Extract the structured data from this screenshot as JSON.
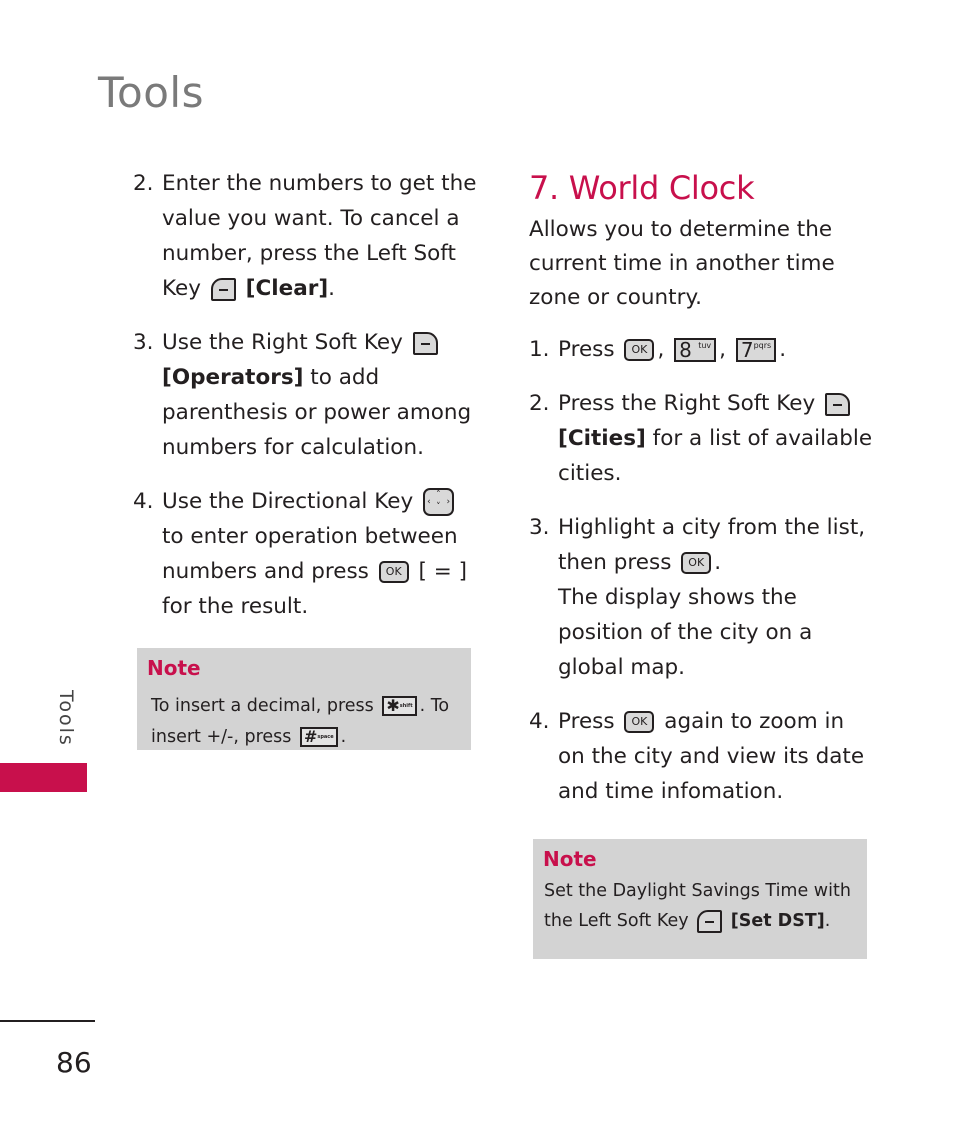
{
  "page": {
    "title": "Tools",
    "side_label": "Tools",
    "page_number": "86",
    "accent_color": "#c8104c"
  },
  "left_column": {
    "steps": [
      {
        "number": "2.",
        "text_before": "Enter the numbers to get the value you want. To cancel a number, press the Left Soft Key",
        "key_icon": "left-soft-key-icon",
        "bold_label": "[Clear]",
        "text_after": "."
      },
      {
        "number": "3.",
        "text_before": "Use the Right Soft Key",
        "key_icon": "right-soft-key-icon",
        "bold_label": "[Operators]",
        "text_after": " to add parenthesis or power among numbers for calculation."
      },
      {
        "number": "4.",
        "text_before": "Use the Directional Key",
        "key_icon": "directional-key-icon",
        "text_mid": " to enter operation between numbers and press",
        "key_icon_2": "ok-key-icon",
        "ok_label": "OK",
        "text_after": " [ = ] for the result."
      }
    ],
    "note": {
      "title": "Note",
      "text_1": "To insert a decimal, press",
      "key_1": {
        "icon": "star-shift-key-icon",
        "main": "✱",
        "sub": "shift"
      },
      "text_2": ". To insert +/-, press",
      "key_2": {
        "icon": "hash-space-key-icon",
        "main": "#",
        "sub": "space"
      },
      "text_3": "."
    }
  },
  "right_column": {
    "heading": "7. World Clock",
    "intro": "Allows you to determine the current time in another time zone or country.",
    "steps": [
      {
        "number": "1.",
        "text": "Press",
        "keys": [
          {
            "icon": "ok-key-icon",
            "label": "OK"
          },
          {
            "icon": "key-8-tuv-icon",
            "main": "8",
            "sub": "tuv"
          },
          {
            "icon": "key-7-pqrs-icon",
            "main": "7",
            "sub": "pqrs"
          }
        ]
      },
      {
        "number": "2.",
        "text_before": "Press the Right Soft Key",
        "key_icon": "right-soft-key-icon",
        "bold_label": "[Cities]",
        "text_after": " for a list of available cities."
      },
      {
        "number": "3.",
        "text_before": "Highlight a city from the list, then press",
        "ok_label": "OK",
        "text_after": ".",
        "text_line2": "The display shows the position of the city on a global map."
      },
      {
        "number": "4.",
        "text_before": "Press",
        "ok_label": "OK",
        "text_after": " again to zoom in on the city and view its date and time infomation."
      }
    ],
    "note": {
      "title": "Note",
      "text_before": "Set the Daylight Savings Time with the Left Soft Key",
      "bold_label": "[Set DST]",
      "text_after": "."
    }
  }
}
